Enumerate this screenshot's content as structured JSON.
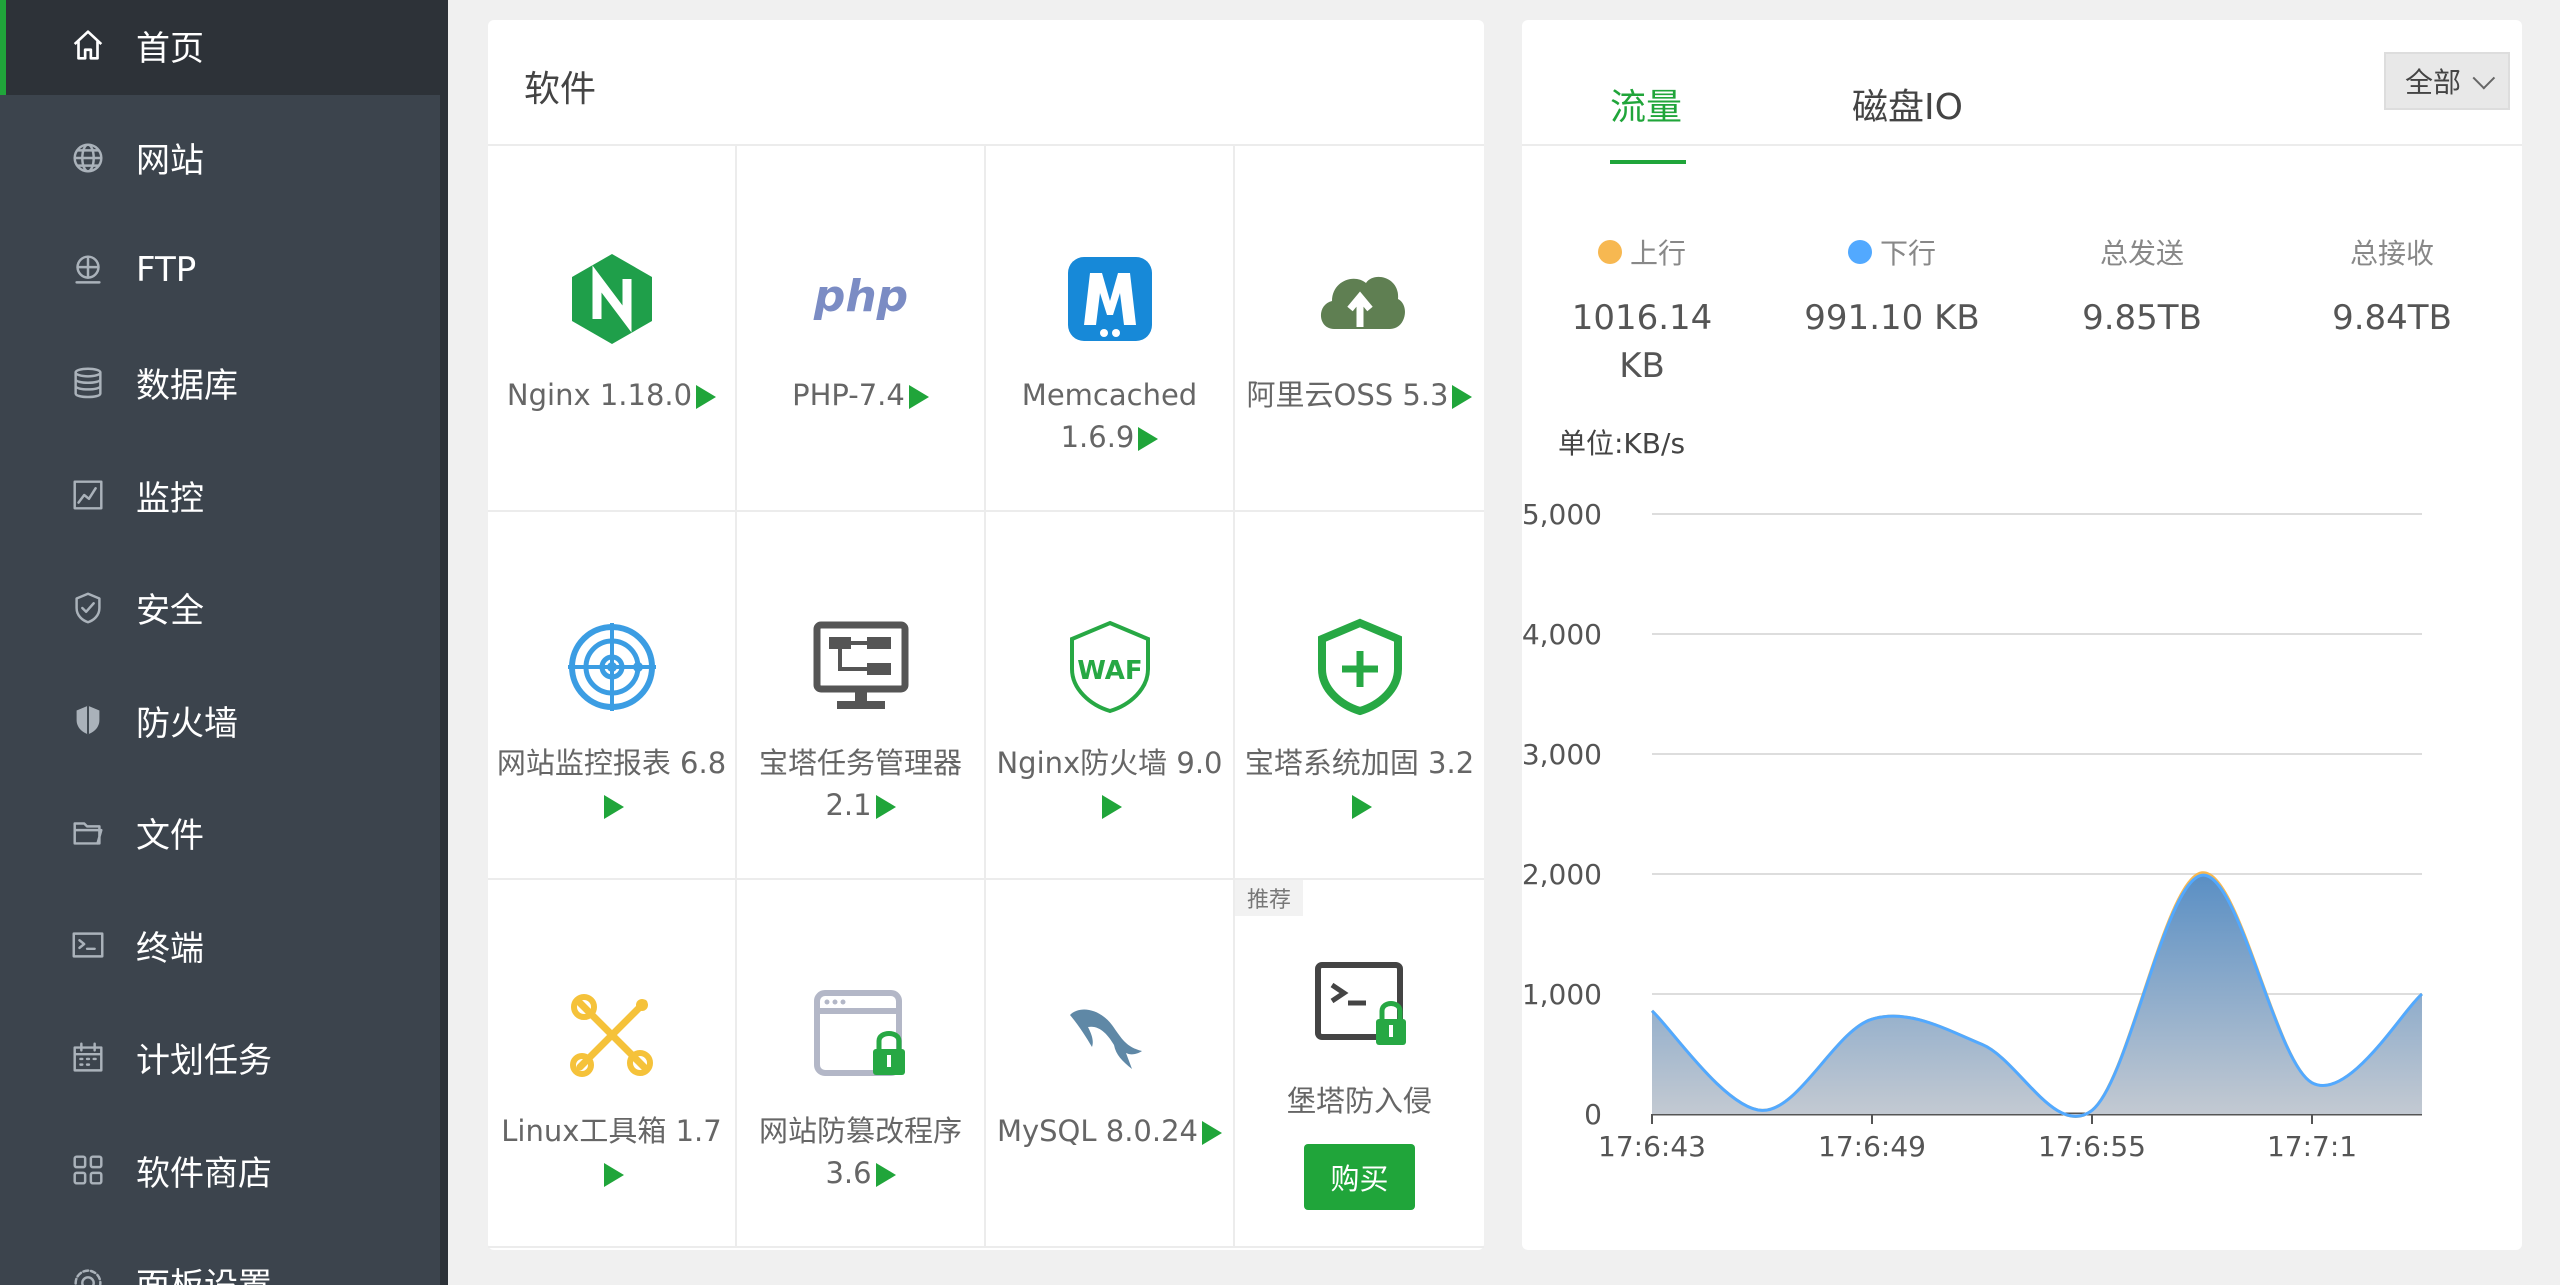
{
  "sidebar": {
    "items": [
      {
        "label": "首页",
        "icon": "home-icon",
        "active": true
      },
      {
        "label": "网站",
        "icon": "globe-icon"
      },
      {
        "label": "FTP",
        "icon": "ftp-icon"
      },
      {
        "label": "数据库",
        "icon": "database-icon"
      },
      {
        "label": "监控",
        "icon": "monitor-chart-icon"
      },
      {
        "label": "安全",
        "icon": "shield-icon"
      },
      {
        "label": "防火墙",
        "icon": "firewall-shield-icon"
      },
      {
        "label": "文件",
        "icon": "folder-icon"
      },
      {
        "label": "终端",
        "icon": "terminal-icon"
      },
      {
        "label": "计划任务",
        "icon": "calendar-icon"
      },
      {
        "label": "软件商店",
        "icon": "grid-apps-icon"
      },
      {
        "label": "面板设置",
        "icon": "gear-icon"
      }
    ]
  },
  "software": {
    "title": "软件",
    "items": [
      {
        "name": "Nginx 1.18.0",
        "icon": "nginx-icon"
      },
      {
        "name": "PHP-7.4",
        "icon": "php-icon"
      },
      {
        "name": "Memcached 1.6.9",
        "icon": "memcached-icon"
      },
      {
        "name": "阿里云OSS 5.3",
        "icon": "aliyun-oss-icon"
      },
      {
        "name": "网站监控报表 6.8",
        "icon": "site-monitor-icon"
      },
      {
        "name": "宝塔任务管理器 2.1",
        "icon": "task-manager-icon"
      },
      {
        "name": "Nginx防火墙 9.0",
        "icon": "waf-icon"
      },
      {
        "name": "宝塔系统加固 3.2",
        "icon": "system-harden-icon"
      },
      {
        "name": "Linux工具箱 1.7",
        "icon": "linux-toolbox-icon"
      },
      {
        "name": "网站防篡改程序 3.6",
        "icon": "tamper-proof-icon"
      },
      {
        "name": "MySQL 8.0.24",
        "icon": "mysql-icon"
      },
      {
        "name": "堡塔防入侵",
        "icon": "intrusion-prevention-icon",
        "tag": "推荐",
        "button": "购买"
      }
    ]
  },
  "traffic": {
    "tabs": [
      "流量",
      "磁盘IO"
    ],
    "select": "全部",
    "stats": [
      {
        "label": "上行",
        "value": "1016.14 KB",
        "color": "#f7b851"
      },
      {
        "label": "下行",
        "value": "991.10 KB",
        "color": "#52a9ff"
      },
      {
        "label": "总发送",
        "value": "9.85TB"
      },
      {
        "label": "总接收",
        "value": "9.84TB"
      }
    ],
    "unit": "单位:KB/s"
  },
  "chart_data": {
    "type": "area",
    "x": [
      "17:6:43",
      "17:6:46",
      "17:6:49",
      "17:6:52",
      "17:6:55",
      "17:6:58",
      "17:7:1",
      "17:7:4"
    ],
    "xticks": [
      "17:6:43",
      "17:6:49",
      "17:6:55",
      "17:7:1"
    ],
    "series": [
      {
        "name": "上行",
        "color": "#f7b851",
        "values": [
          860,
          30,
          790,
          580,
          30,
          2010,
          260,
          1000
        ]
      },
      {
        "name": "下行",
        "color": "#52a9ff",
        "values": [
          860,
          30,
          790,
          580,
          30,
          1990,
          260,
          1000
        ]
      }
    ],
    "yticks": [
      "0",
      "1,000",
      "2,000",
      "3,000",
      "4,000",
      "5,000"
    ],
    "ylim": [
      0,
      5000
    ],
    "grid": true
  }
}
